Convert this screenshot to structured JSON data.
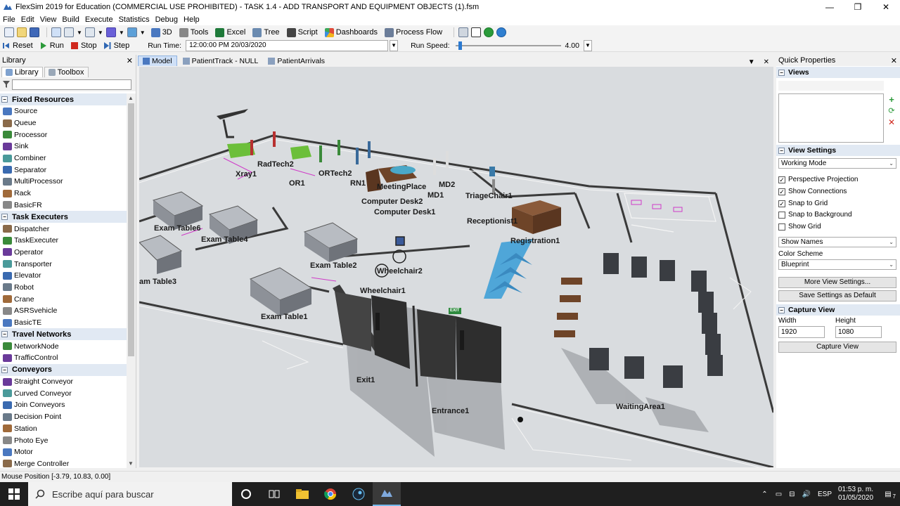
{
  "window": {
    "title": "FlexSim 2019 for Education (COMMERCIAL USE PROHIBITED) - TASK 1.4 - ADD TRANSPORT AND EQUIPMENT OBJECTS (1).fsm",
    "minimize": "—",
    "maximize": "❐",
    "close": "✕"
  },
  "menu": [
    "File",
    "Edit",
    "View",
    "Build",
    "Execute",
    "Statistics",
    "Debug",
    "Help"
  ],
  "toolbar": {
    "view3d": "3D",
    "tools": "Tools",
    "excel": "Excel",
    "tree": "Tree",
    "script": "Script",
    "dashboards": "Dashboards",
    "process_flow": "Process Flow"
  },
  "run": {
    "reset": "Reset",
    "run": "Run",
    "stop": "Stop",
    "step": "Step",
    "run_time_label": "Run Time:",
    "run_time_value": "12:00:00 PM  20/03/2020",
    "run_speed_label": "Run Speed:",
    "run_speed_value": "4.00",
    "run_speed_level": 0.03
  },
  "library": {
    "title": "Library",
    "close": "✕",
    "tabs": [
      "Library",
      "Toolbox"
    ],
    "categories": [
      {
        "name": "Fixed Resources",
        "items": [
          "Source",
          "Queue",
          "Processor",
          "Sink",
          "Combiner",
          "Separator",
          "MultiProcessor",
          "Rack",
          "BasicFR"
        ]
      },
      {
        "name": "Task Executers",
        "items": [
          "Dispatcher",
          "TaskExecuter",
          "Operator",
          "Transporter",
          "Elevator",
          "Robot",
          "Crane",
          "ASRSvehicle",
          "BasicTE"
        ]
      },
      {
        "name": "Travel Networks",
        "items": [
          "NetworkNode",
          "TrafficControl"
        ]
      },
      {
        "name": "Conveyors",
        "items": [
          "Straight Conveyor",
          "Curved Conveyor",
          "Join Conveyors",
          "Decision Point",
          "Station",
          "Photo Eye",
          "Motor",
          "Merge Controller"
        ]
      }
    ]
  },
  "view_tabs": [
    "Model",
    "PatientTrack - NULL",
    "PatientArrivals"
  ],
  "view_controls": {
    "menu": "▼",
    "close": "✕"
  },
  "model_labels": [
    {
      "id": "xray1",
      "text": "Xray1"
    },
    {
      "id": "radtech2",
      "text": "RadTech2"
    },
    {
      "id": "or1",
      "text": "OR1"
    },
    {
      "id": "ortech2",
      "text": "ORTech2"
    },
    {
      "id": "rn1",
      "text": "RN1"
    },
    {
      "id": "meetingplace",
      "text": "MeetingPlace"
    },
    {
      "id": "md2",
      "text": "MD2"
    },
    {
      "id": "md1",
      "text": "MD1"
    },
    {
      "id": "triagechair1",
      "text": "TriageChair1"
    },
    {
      "id": "computerdesk2",
      "text": "Computer Desk2"
    },
    {
      "id": "computerdesk1",
      "text": "Computer Desk1"
    },
    {
      "id": "receptionist1",
      "text": "Receptionist1"
    },
    {
      "id": "examtable6",
      "text": "Exam Table6"
    },
    {
      "id": "examtable4",
      "text": "Exam Table4"
    },
    {
      "id": "registration1",
      "text": "Registration1"
    },
    {
      "id": "examtable2",
      "text": "Exam Table2"
    },
    {
      "id": "wheelchair2",
      "text": "Wheelchair2"
    },
    {
      "id": "examtable3",
      "text": "am Table3"
    },
    {
      "id": "wheelchair1",
      "text": "Wheelchair1"
    },
    {
      "id": "examtable1",
      "text": "Exam Table1"
    },
    {
      "id": "exit1",
      "text": "Exit1"
    },
    {
      "id": "entrance1",
      "text": "Entrance1"
    },
    {
      "id": "waitingarea1",
      "text": "WaitingArea1"
    },
    {
      "id": "exit_sign",
      "text": "EXIT"
    }
  ],
  "quick_properties": {
    "title": "Quick Properties",
    "close": "✕",
    "views_section": "Views",
    "view_settings_section": "View Settings",
    "view_mode": "Working Mode",
    "checks": [
      {
        "label": "Perspective Projection",
        "checked": true
      },
      {
        "label": "Show Connections",
        "checked": true
      },
      {
        "label": "Snap to Grid",
        "checked": true
      },
      {
        "label": "Snap to Background",
        "checked": false
      },
      {
        "label": "Show Grid",
        "checked": false
      }
    ],
    "show_names": "Show Names",
    "color_scheme_label": "Color Scheme",
    "color_scheme": "Blueprint",
    "more_view_settings": "More View Settings...",
    "save_settings": "Save Settings as Default",
    "capture_section": "Capture View",
    "width_label": "Width",
    "height_label": "Height",
    "width_value": "1920",
    "height_value": "1080",
    "capture_button": "Capture View"
  },
  "status": {
    "mouse_position": "Mouse Position [-3.79, 10.83, 0.00]"
  },
  "taskbar": {
    "search_placeholder": "Escribe aquí para buscar",
    "lang": "ESP",
    "time": "01:53 p. m.",
    "date": "01/05/2020",
    "notifications": "7"
  },
  "colors": {
    "accent": "#2b79d0",
    "category_bg": "#e1e9f3",
    "floor": "#d9dcdf",
    "taskbar": "#1f1f1f"
  }
}
